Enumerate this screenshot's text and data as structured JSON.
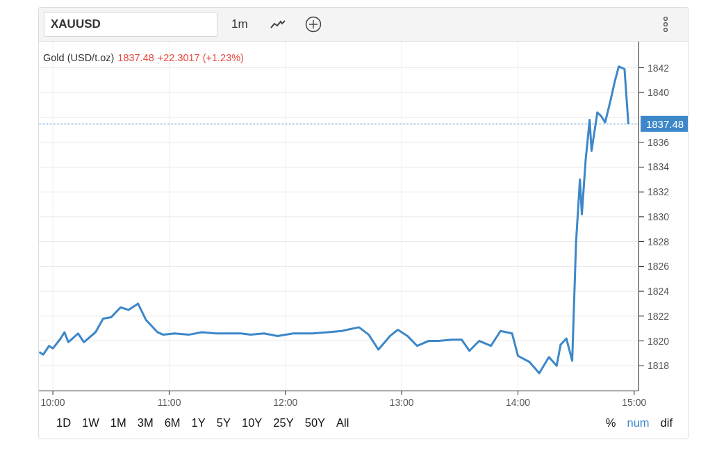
{
  "toolbar": {
    "symbol": "XAUUSD",
    "interval": "1m"
  },
  "legend": {
    "price": "1837.48",
    "change": "+22.3017 (+1.23%)"
  },
  "price_label": "1837.48",
  "chart_data": {
    "type": "line",
    "grid": true,
    "ref_lines": [
      {
        "axis": "y",
        "value": 1837.48
      }
    ],
    "xlim": [
      9.88,
      15.037
    ],
    "ylim": [
      1816,
      1844.1
    ],
    "xticks": [
      {
        "value": 10,
        "label": "10:00"
      },
      {
        "value": 11,
        "label": "11:00"
      },
      {
        "value": 12,
        "label": "12:00"
      },
      {
        "value": 13,
        "label": "13:00"
      },
      {
        "value": 14,
        "label": "14:00"
      },
      {
        "value": 15,
        "label": "15:00"
      }
    ],
    "yticks": [
      1818,
      1820,
      1822,
      1824,
      1826,
      1828,
      1830,
      1832,
      1834,
      1836,
      1840,
      1842
    ],
    "x": [
      9.883,
      9.917,
      9.967,
      10,
      10.067,
      10.1,
      10.133,
      10.217,
      10.267,
      10.367,
      10.433,
      10.5,
      10.583,
      10.65,
      10.733,
      10.8,
      10.9,
      10.95,
      11.05,
      11.167,
      11.283,
      11.4,
      11.517,
      11.617,
      11.7,
      11.817,
      11.933,
      12.067,
      12.233,
      12.367,
      12.483,
      12.633,
      12.717,
      12.8,
      12.9,
      12.967,
      13.05,
      13.133,
      13.233,
      13.317,
      13.433,
      13.517,
      13.583,
      13.667,
      13.767,
      13.85,
      13.95,
      14,
      14.1,
      14.183,
      14.267,
      14.333,
      14.367,
      14.417,
      14.467,
      14.5,
      14.533,
      14.55,
      14.583,
      14.617,
      14.633,
      14.683,
      14.717,
      14.75,
      14.8,
      14.833,
      14.867,
      14.917,
      14.95
    ],
    "series": [
      {
        "name": "Gold (USD/t.oz)",
        "color": "#3d87c9",
        "values": [
          1819.1,
          1818.9,
          1819.6,
          1819.4,
          1820.2,
          1820.7,
          1819.9,
          1820.6,
          1819.9,
          1820.7,
          1821.8,
          1821.9,
          1822.7,
          1822.5,
          1823.0,
          1821.7,
          1820.7,
          1820.5,
          1820.6,
          1820.5,
          1820.7,
          1820.6,
          1820.6,
          1820.6,
          1820.5,
          1820.6,
          1820.4,
          1820.6,
          1820.6,
          1820.7,
          1820.8,
          1821.1,
          1820.5,
          1819.3,
          1820.4,
          1820.9,
          1820.4,
          1819.6,
          1820.0,
          1820.0,
          1820.1,
          1820.1,
          1819.2,
          1820.0,
          1819.6,
          1820.8,
          1820.6,
          1818.8,
          1818.3,
          1817.4,
          1818.7,
          1818.0,
          1819.7,
          1820.2,
          1818.4,
          1827.9,
          1833.0,
          1830.2,
          1834.6,
          1837.8,
          1835.3,
          1838.4,
          1838.1,
          1837.6,
          1839.5,
          1840.9,
          1842.1,
          1841.9,
          1837.48
        ]
      }
    ]
  },
  "ranges": [
    {
      "label": "1D",
      "selected": false
    },
    {
      "label": "1W",
      "selected": false
    },
    {
      "label": "1M",
      "selected": false
    },
    {
      "label": "3M",
      "selected": false
    },
    {
      "label": "6M",
      "selected": false
    },
    {
      "label": "1Y",
      "selected": false
    },
    {
      "label": "5Y",
      "selected": false
    },
    {
      "label": "10Y",
      "selected": false
    },
    {
      "label": "25Y",
      "selected": false
    },
    {
      "label": "50Y",
      "selected": false
    },
    {
      "label": "All",
      "selected": false
    }
  ],
  "modes": [
    {
      "label": "%",
      "selected": false
    },
    {
      "label": "num",
      "selected": true
    },
    {
      "label": "dif",
      "selected": false
    }
  ]
}
